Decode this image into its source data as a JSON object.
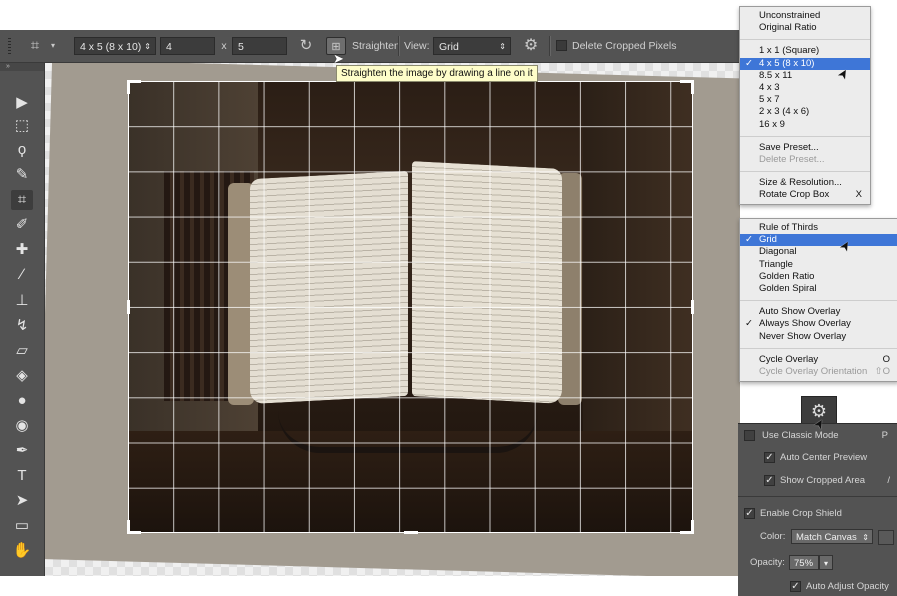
{
  "optionsbar": {
    "preset": "4 x 5 (8 x 10)",
    "width_value": "4",
    "x_sep": "x",
    "height_value": "5",
    "straighten_label": "Straighten",
    "view_label": "View:",
    "view_value": "Grid",
    "delete_cropped_label": "Delete Cropped Pixels"
  },
  "tooltip": "Straighten the image by drawing a line on it",
  "ratio_menu": {
    "items": [
      {
        "label": "Unconstrained"
      },
      {
        "label": "Original Ratio"
      },
      {
        "label": "1 x 1 (Square)"
      },
      {
        "label": "4 x 5 (8 x 10)",
        "checked": "✓"
      },
      {
        "label": "8.5 x 11"
      },
      {
        "label": "4 x 3"
      },
      {
        "label": "5 x 7"
      },
      {
        "label": "2 x 3 (4 x 6)"
      },
      {
        "label": "16 x 9"
      },
      {
        "label": "Save Preset..."
      },
      {
        "label": "Delete Preset..."
      },
      {
        "label": "Size & Resolution..."
      },
      {
        "label": "Rotate Crop Box",
        "shortcut": "X"
      }
    ]
  },
  "overlay_menu": {
    "items": [
      {
        "label": "Rule of Thirds"
      },
      {
        "label": "Grid",
        "checked": "✓"
      },
      {
        "label": "Diagonal"
      },
      {
        "label": "Triangle"
      },
      {
        "label": "Golden Ratio"
      },
      {
        "label": "Golden Spiral"
      },
      {
        "label": "Auto Show Overlay"
      },
      {
        "label": "Always Show Overlay",
        "checked": "✓"
      },
      {
        "label": "Never Show Overlay"
      },
      {
        "label": "Cycle Overlay",
        "shortcut": "O"
      },
      {
        "label": "Cycle Overlay Orientation",
        "shortcut": "⇧O"
      }
    ]
  },
  "settings_panel": {
    "use_classic_mode": "Use Classic Mode",
    "use_classic_mode_shortcut": "P",
    "auto_center_preview": "Auto Center Preview",
    "show_cropped_area": "Show Cropped Area",
    "show_cropped_area_shortcut": "/",
    "enable_crop_shield": "Enable Crop Shield",
    "color_label": "Color:",
    "color_value": "Match Canvas",
    "opacity_label": "Opacity:",
    "opacity_value": "75%",
    "auto_adjust_opacity": "Auto Adjust Opacity"
  },
  "toolbar": {
    "collapse_glyph": "»",
    "tools": [
      {
        "name": "move-tool-icon",
        "glyph": "▶"
      },
      {
        "name": "marquee-tool-icon",
        "glyph": "⬚"
      },
      {
        "name": "lasso-tool-icon",
        "glyph": "ϙ"
      },
      {
        "name": "quick-selection-tool-icon",
        "glyph": "✎"
      },
      {
        "name": "crop-tool-icon",
        "glyph": "⌗"
      },
      {
        "name": "eyedropper-tool-icon",
        "glyph": "✐"
      },
      {
        "name": "healing-brush-tool-icon",
        "glyph": "✚"
      },
      {
        "name": "brush-tool-icon",
        "glyph": "∕"
      },
      {
        "name": "clone-stamp-tool-icon",
        "glyph": "⊥"
      },
      {
        "name": "history-brush-tool-icon",
        "glyph": "↯"
      },
      {
        "name": "eraser-tool-icon",
        "glyph": "▱"
      },
      {
        "name": "paint-bucket-tool-icon",
        "glyph": "◈"
      },
      {
        "name": "blur-tool-icon",
        "glyph": "●"
      },
      {
        "name": "dodge-tool-icon",
        "glyph": "◉"
      },
      {
        "name": "pen-tool-icon",
        "glyph": "✒"
      },
      {
        "name": "type-tool-icon",
        "glyph": "T"
      },
      {
        "name": "path-selection-tool-icon",
        "glyph": "➤"
      },
      {
        "name": "rectangle-tool-icon",
        "glyph": "▭"
      },
      {
        "name": "hand-tool-icon",
        "glyph": "✋"
      }
    ]
  }
}
